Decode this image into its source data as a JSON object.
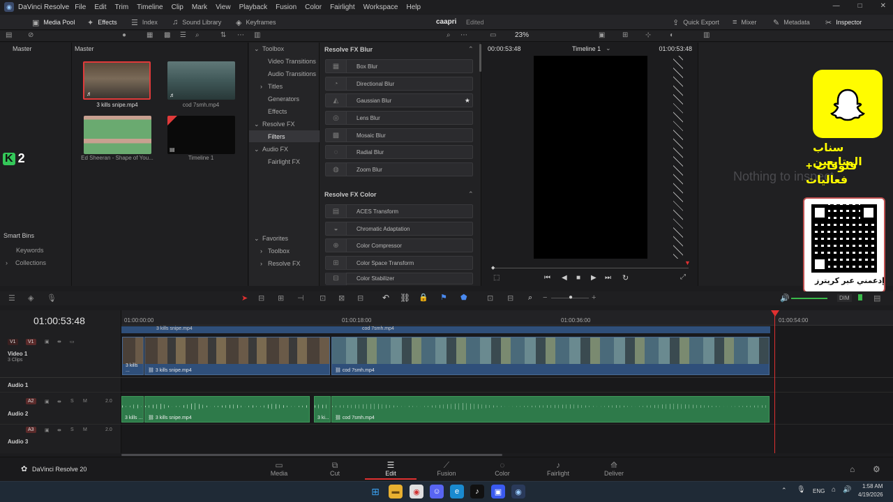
{
  "app": {
    "title": "DaVinci Resolve"
  },
  "menu": [
    "File",
    "Edit",
    "Trim",
    "Timeline",
    "Clip",
    "Mark",
    "View",
    "Playback",
    "Fusion",
    "Color",
    "Fairlight",
    "Workspace",
    "Help"
  ],
  "tabs": {
    "media_pool": "Media Pool",
    "effects": "Effects",
    "index": "Index",
    "sound_library": "Sound Library",
    "keyframes": "Keyframes",
    "quick_export": "Quick Export",
    "mixer": "Mixer",
    "metadata": "Metadata",
    "inspector": "Inspector"
  },
  "project": {
    "name": "caapri",
    "status": "Edited"
  },
  "viewer": {
    "zoom": "23%",
    "timecode_left": "00:00:53:48",
    "timeline_name": "Timeline 1",
    "timecode_right": "01:00:53:48"
  },
  "bins": {
    "master_left": "Master",
    "master_right": "Master",
    "smart_bins": "Smart Bins",
    "keywords": "Keywords",
    "collections": "Collections"
  },
  "media": [
    {
      "name": "3 kills snipe.mp4"
    },
    {
      "name": "cod 7smh.mp4"
    },
    {
      "name": "Ed Sheeran - Shape of You..."
    },
    {
      "name": "Timeline 1"
    }
  ],
  "fxtree": {
    "toolbox": "Toolbox",
    "video_transitions": "Video Transitions",
    "audio_transitions": "Audio Transitions",
    "titles": "Titles",
    "generators": "Generators",
    "effects": "Effects",
    "resolve_fx": "Resolve FX",
    "filters": "Filters",
    "audio_fx": "Audio FX",
    "fairlight_fx": "Fairlight FX",
    "favorites": "Favorites",
    "fav_toolbox": "Toolbox",
    "fav_resolve_fx": "Resolve FX"
  },
  "fx": {
    "blur_header": "Resolve FX Blur",
    "blur": [
      "Box Blur",
      "Directional Blur",
      "Gaussian Blur",
      "Lens Blur",
      "Mosaic Blur",
      "Radial Blur",
      "Zoom Blur"
    ],
    "color_header": "Resolve FX Color",
    "color": [
      "ACES Transform",
      "Chromatic Adaptation",
      "Color Compressor",
      "Color Space Transform",
      "Color Stabilizer"
    ]
  },
  "inspector": {
    "empty": "Nothing to inspect"
  },
  "overlay": {
    "badge_k": "K",
    "badge_num": "2",
    "snap_line1": "سناب المتابعين",
    "snap_line2": "فلوقات + فعاليات",
    "qr_caption": "إدعمني عبر كريترز"
  },
  "timeline": {
    "timecode": "01:00:53:48",
    "ruler": [
      "01:00:00:00",
      "01:00:18:00",
      "01:00:36:00",
      "01:00:54:00"
    ],
    "video_track": {
      "name": "Video 1",
      "clips": "3 Clips",
      "badge_a": "V1",
      "badge_b": "V1"
    },
    "audio1": {
      "name": "Audio 1"
    },
    "audio2": {
      "name": "Audio 2",
      "badge": "A2",
      "level": "2.0"
    },
    "audio3": {
      "name": "Audio 3",
      "badge": "A3",
      "level": "2.0"
    },
    "dim": "DIM",
    "clip_a": "3 kills snipe.mp4",
    "clip_a_short": "3 kills ...",
    "clip_a_tiny": "3 kil...",
    "clip_b": "cod 7smh.mp4",
    "audio_clip_a": "3 kills snipe.mp4",
    "audio_clip_short": "3 kills ...",
    "audio_clip_tiny": "3 ki...",
    "audio_clip_b": "cod 7smh.mp4"
  },
  "pages": [
    "Media",
    "Cut",
    "Edit",
    "Fusion",
    "Color",
    "Fairlight",
    "Deliver"
  ],
  "brand": "DaVinci Resolve 20",
  "taskbar": {
    "lang": "ENG",
    "time": "1:58 AM",
    "date": "4/19/2026"
  }
}
